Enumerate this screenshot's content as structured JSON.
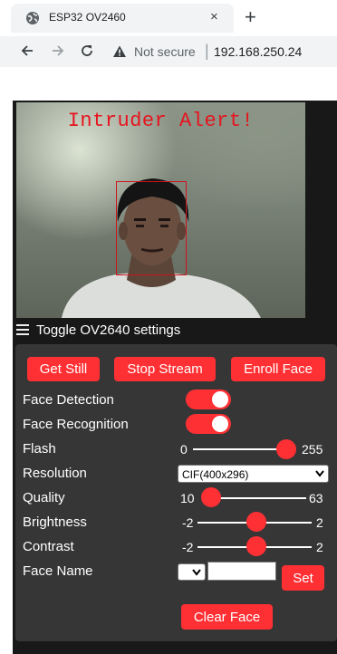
{
  "browser": {
    "tab_title": "ESP32 OV2460",
    "tab_close": "×",
    "new_tab": "+",
    "security_label": "Not secure",
    "separator": "|",
    "url": "192.168.250.24"
  },
  "stream": {
    "overlay_text": "Intruder Alert!",
    "overlay_color": "#e6141e"
  },
  "settings_toggle": {
    "label": "Toggle OV2640 settings",
    "icon": "hamburger-icon"
  },
  "buttons": {
    "get_still": "Get Still",
    "stop_stream": "Stop Stream",
    "enroll_face": "Enroll Face",
    "set": "Set",
    "clear_face": "Clear Face"
  },
  "controls": {
    "face_detection": {
      "label": "Face Detection",
      "on": true
    },
    "face_recognition": {
      "label": "Face Recognition",
      "on": true
    },
    "flash": {
      "label": "Flash",
      "min": "0",
      "max": "255",
      "value": 255
    },
    "resolution": {
      "label": "Resolution",
      "selected": "CIF(400x296)"
    },
    "quality": {
      "label": "Quality",
      "min": "10",
      "max": "63",
      "value": 10
    },
    "brightness": {
      "label": "Brightness",
      "min": "-2",
      "max": "2",
      "value": 0
    },
    "contrast": {
      "label": "Contrast",
      "min": "-2",
      "max": "2",
      "value": 0
    },
    "face_name": {
      "label": "Face Name",
      "selected": "",
      "value": ""
    }
  },
  "colors": {
    "accent": "#ff3034",
    "app_background": "#181818",
    "panel_background": "#363636"
  }
}
